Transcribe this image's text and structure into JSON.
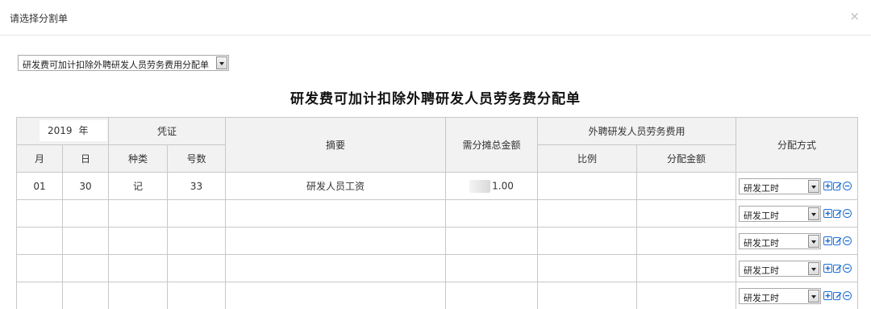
{
  "dialog": {
    "title": "请选择分割单",
    "close_label": "×"
  },
  "form_selector": {
    "selected": "研发费可加计扣除外聘研发人员劳务费用分配单"
  },
  "sheet": {
    "title": "研发费可加计扣除外聘研发人员劳务费分配单",
    "year": "2019",
    "year_label": "年",
    "headers": {
      "voucher": "凭证",
      "summary": "摘要",
      "total_amount": "需分摊总金额",
      "external_fee": "外聘研发人员劳务费用",
      "alloc_method": "分配方式",
      "month": "月",
      "day": "日",
      "type": "种类",
      "number": "号数",
      "ratio": "比例",
      "alloc_amount": "分配金额"
    },
    "rows": [
      {
        "month": "01",
        "day": "30",
        "type": "记",
        "number": "33",
        "summary": "研发人员工资",
        "amount": "1.00",
        "ratio": "",
        "alloc_amount": "",
        "method": "研发工时"
      },
      {
        "month": "",
        "day": "",
        "type": "",
        "number": "",
        "summary": "",
        "amount": "",
        "ratio": "",
        "alloc_amount": "",
        "method": "研发工时"
      },
      {
        "month": "",
        "day": "",
        "type": "",
        "number": "",
        "summary": "",
        "amount": "",
        "ratio": "",
        "alloc_amount": "",
        "method": "研发工时"
      },
      {
        "month": "",
        "day": "",
        "type": "",
        "number": "",
        "summary": "",
        "amount": "",
        "ratio": "",
        "alloc_amount": "",
        "method": "研发工时"
      },
      {
        "month": "",
        "day": "",
        "type": "",
        "number": "",
        "summary": "",
        "amount": "",
        "ratio": "",
        "alloc_amount": "",
        "method": "研发工时"
      }
    ]
  },
  "icons": {
    "add": "plus-square-icon",
    "edit": "edit-icon",
    "remove": "minus-circle-icon",
    "accent": "#1f6fd1"
  }
}
